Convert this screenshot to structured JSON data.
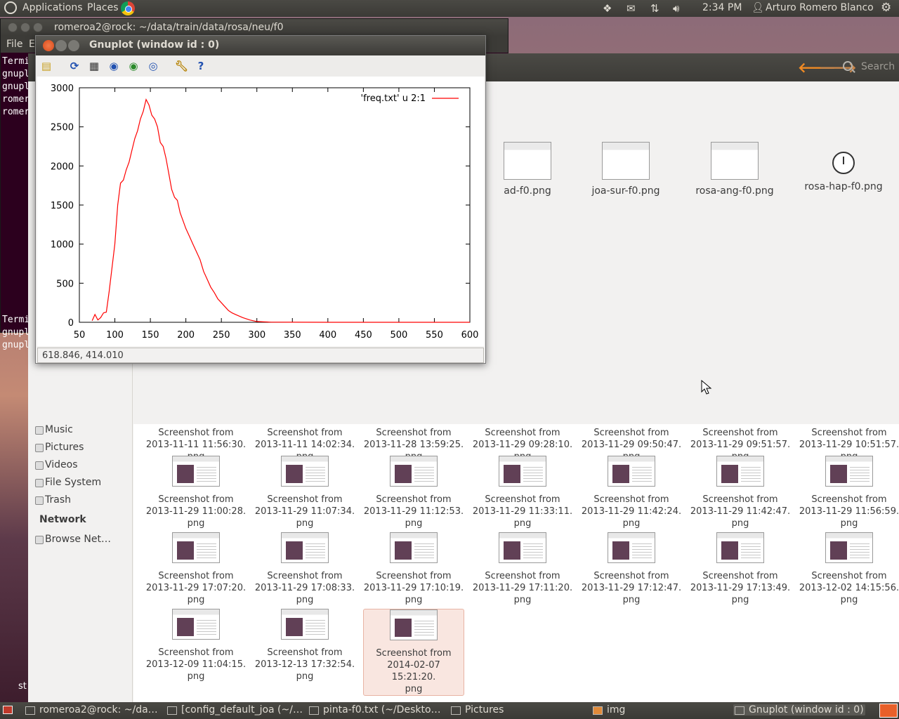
{
  "top_panel": {
    "applications": "Applications",
    "places": "Places",
    "clock": "2:34 PM",
    "user": "Arturo Romero Blanco"
  },
  "terminal": {
    "title": "romeroa2@rock: ~/data/train/data/rosa/neu/f0",
    "menu_file": "File",
    "menu_edit": "E",
    "lines_top": [
      "Termi",
      "gnuplo",
      "gnuplo",
      "romero",
      "romero"
    ],
    "lines_bottom": [
      "Termi",
      "gnuplo",
      "gnuplo"
    ]
  },
  "gnuplot": {
    "title": "Gnuplot (window id : 0)",
    "status": "618.846,  414.010"
  },
  "chart_data": {
    "type": "line",
    "legend": "'freq.txt' u 2:1",
    "legend_position": "top-right",
    "color": "#ff0000",
    "xlim": [
      50,
      600
    ],
    "ylim": [
      0,
      3000
    ],
    "xticks": [
      50,
      100,
      150,
      200,
      250,
      300,
      350,
      400,
      450,
      500,
      550,
      600
    ],
    "yticks": [
      0,
      500,
      1000,
      1500,
      2000,
      2500,
      3000
    ],
    "series": [
      {
        "x": [
          68,
          72,
          76,
          80,
          84,
          88,
          92,
          96,
          100,
          104,
          108,
          112,
          116,
          120,
          124,
          128,
          132,
          136,
          140,
          144,
          148,
          152,
          156,
          160,
          164,
          168,
          172,
          176,
          180,
          184,
          188,
          192,
          196,
          200,
          205,
          210,
          215,
          220,
          225,
          230,
          235,
          240,
          245,
          250,
          255,
          260,
          265,
          270,
          280,
          290,
          300,
          310,
          320,
          350,
          400,
          450,
          500,
          550,
          600
        ],
        "y": [
          20,
          100,
          30,
          60,
          120,
          130,
          400,
          700,
          1000,
          1500,
          1780,
          1820,
          1950,
          2050,
          2200,
          2350,
          2450,
          2600,
          2700,
          2850,
          2780,
          2650,
          2600,
          2500,
          2300,
          2250,
          2100,
          1900,
          1700,
          1600,
          1560,
          1400,
          1300,
          1200,
          1100,
          1000,
          900,
          800,
          650,
          550,
          450,
          380,
          300,
          250,
          200,
          150,
          120,
          100,
          60,
          30,
          10,
          5,
          2,
          1,
          0,
          0,
          0,
          0,
          0
        ]
      }
    ]
  },
  "file_manager": {
    "search_placeholder": "Search",
    "top_files": [
      "ad-f0.png",
      "joa-sur-f0.png",
      "rosa-ang-f0.png",
      "rosa-hap-f0.png"
    ],
    "sidebar": {
      "music": "Music",
      "pictures": "Pictures",
      "videos": "Videos",
      "filesystem": "File System",
      "trash": "Trash",
      "network_header": "Network",
      "browse_network": "Browse Net…"
    },
    "files": [
      {
        "l1": "Screenshot from",
        "l2": "2013-11-11 11:56:30.",
        "l3": "png"
      },
      {
        "l1": "Screenshot from",
        "l2": "2013-11-11 14:02:34.",
        "l3": "png"
      },
      {
        "l1": "Screenshot from",
        "l2": "2013-11-28 13:59:25.",
        "l3": "png"
      },
      {
        "l1": "Screenshot from",
        "l2": "2013-11-29 09:28:10.",
        "l3": "png"
      },
      {
        "l1": "Screenshot from",
        "l2": "2013-11-29 09:50:47.",
        "l3": "png"
      },
      {
        "l1": "Screenshot from",
        "l2": "2013-11-29 09:51:57.",
        "l3": "png"
      },
      {
        "l1": "Screenshot from",
        "l2": "2013-11-29 10:51:57.",
        "l3": "png"
      },
      {
        "l1": "Screenshot from",
        "l2": "2013-11-29 11:00:28.",
        "l3": "png"
      },
      {
        "l1": "Screenshot from",
        "l2": "2013-11-29 11:07:34.",
        "l3": "png"
      },
      {
        "l1": "Screenshot from",
        "l2": "2013-11-29 11:12:53.",
        "l3": "png"
      },
      {
        "l1": "Screenshot from",
        "l2": "2013-11-29 11:33:11.",
        "l3": "png"
      },
      {
        "l1": "Screenshot from",
        "l2": "2013-11-29 11:42:24.",
        "l3": "png"
      },
      {
        "l1": "Screenshot from",
        "l2": "2013-11-29 11:42:47.",
        "l3": "png"
      },
      {
        "l1": "Screenshot from",
        "l2": "2013-11-29 11:56:59.",
        "l3": "png"
      },
      {
        "l1": "Screenshot from",
        "l2": "2013-11-29 17:07:20.",
        "l3": "png"
      },
      {
        "l1": "Screenshot from",
        "l2": "2013-11-29 17:08:33.",
        "l3": "png"
      },
      {
        "l1": "Screenshot from",
        "l2": "2013-11-29 17:10:19.",
        "l3": "png"
      },
      {
        "l1": "Screenshot from",
        "l2": "2013-11-29 17:11:20.",
        "l3": "png"
      },
      {
        "l1": "Screenshot from",
        "l2": "2013-11-29 17:12:47.",
        "l3": "png"
      },
      {
        "l1": "Screenshot from",
        "l2": "2013-11-29 17:13:49.",
        "l3": "png"
      },
      {
        "l1": "Screenshot from",
        "l2": "2013-12-02 14:15:56.",
        "l3": "png"
      },
      {
        "l1": "Screenshot from",
        "l2": "2013-12-09 11:04:15.",
        "l3": "png"
      },
      {
        "l1": "Screenshot from",
        "l2": "2013-12-13 17:32:54.",
        "l3": "png"
      },
      {
        "l1": "Screenshot from",
        "l2": "2014-02-07 15:21:20.",
        "l3": "png",
        "selected": true
      }
    ]
  },
  "taskbar": [
    "romeroa2@rock: ~/da…",
    "[config_default_joa (~/…",
    "pinta-f0.txt (~/Deskto…",
    "Pictures",
    "img",
    "Gnuplot (window id : 0)"
  ],
  "desktop_fragment": "st"
}
